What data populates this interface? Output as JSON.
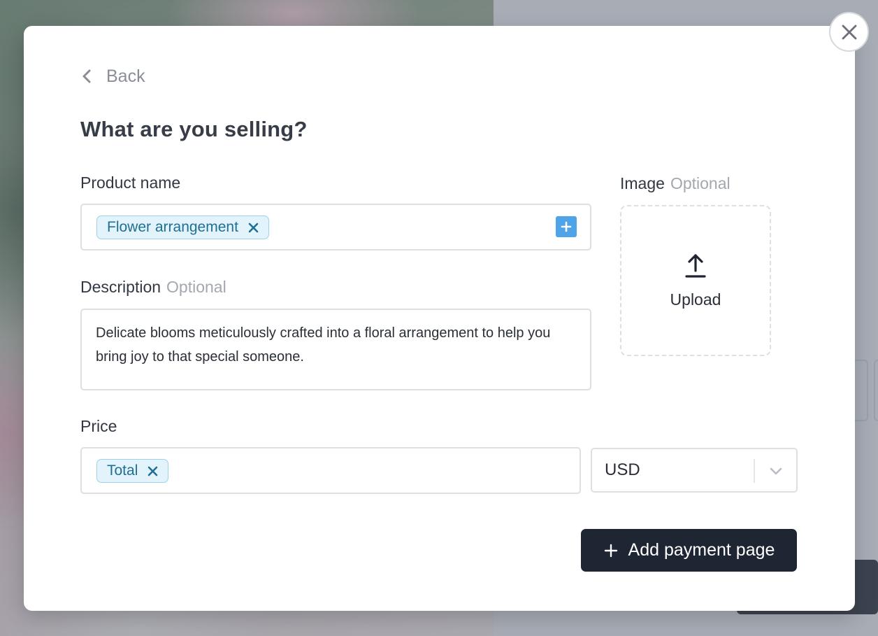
{
  "dialog": {
    "back_label": "Back",
    "title": "What are you selling?"
  },
  "product_name": {
    "label": "Product name",
    "chip_value": "Flower arrangement"
  },
  "image": {
    "label": "Image",
    "optional_label": "Optional",
    "upload_label": "Upload"
  },
  "description": {
    "label": "Description",
    "optional_label": "Optional",
    "value": "Delicate blooms meticulously crafted into a floral arrangement to help you bring joy to that special someone."
  },
  "price": {
    "label": "Price",
    "chip_value": "Total",
    "currency": "USD"
  },
  "actions": {
    "submit_label": "Add payment page"
  },
  "icons": {
    "close": "close-icon",
    "back": "chevron-left-icon",
    "chip_remove": "x-icon",
    "add": "plus-icon",
    "upload": "upload-arrow-icon",
    "dropdown": "chevron-down-icon"
  },
  "colors": {
    "chip_bg": "#e3f3fb",
    "chip_border": "#9cd2ea",
    "chip_text": "#1f6f93",
    "add_button": "#4fa3e8",
    "primary_button": "#1e2533"
  }
}
